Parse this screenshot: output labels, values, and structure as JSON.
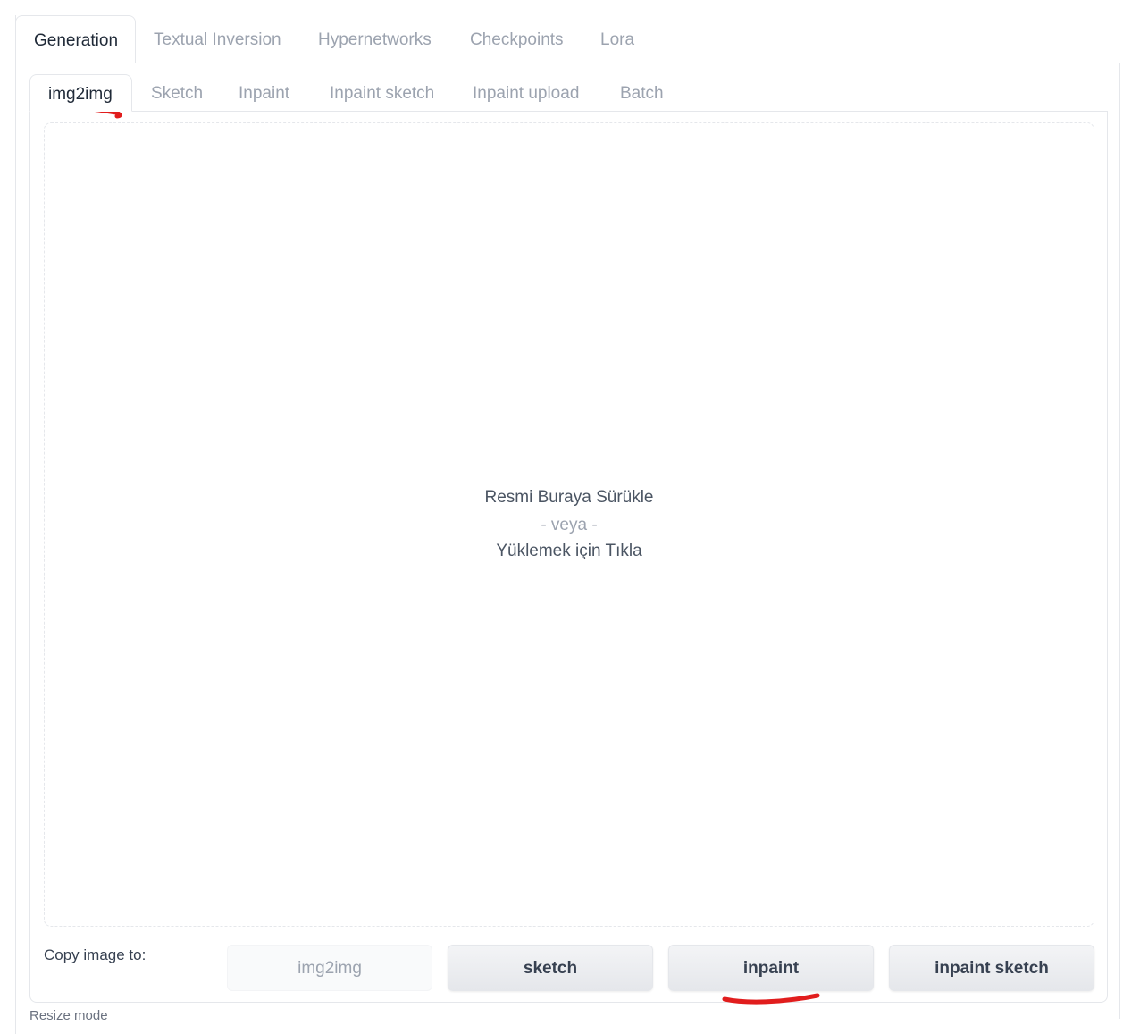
{
  "main_tabs": [
    {
      "label": "Generation",
      "active": true
    },
    {
      "label": "Textual Inversion",
      "active": false
    },
    {
      "label": "Hypernetworks",
      "active": false
    },
    {
      "label": "Checkpoints",
      "active": false
    },
    {
      "label": "Lora",
      "active": false
    }
  ],
  "sub_tabs": [
    {
      "label": "img2img",
      "active": true
    },
    {
      "label": "Sketch",
      "active": false
    },
    {
      "label": "Inpaint",
      "active": false
    },
    {
      "label": "Inpaint sketch",
      "active": false
    },
    {
      "label": "Inpaint upload",
      "active": false
    },
    {
      "label": "Batch",
      "active": false
    }
  ],
  "dropzone": {
    "line1": "Resmi Buraya Sürükle",
    "line2": "- veya -",
    "line3": "Yüklemek için Tıkla"
  },
  "copy": {
    "label": "Copy image to:",
    "buttons": [
      {
        "label": "img2img",
        "disabled": true
      },
      {
        "label": "sketch",
        "disabled": false
      },
      {
        "label": "inpaint",
        "disabled": false
      },
      {
        "label": "inpaint sketch",
        "disabled": false
      }
    ]
  },
  "resize_label": "Resize mode",
  "colors": {
    "annotation": "#e11d1d",
    "accent_text": "#1f2937"
  }
}
